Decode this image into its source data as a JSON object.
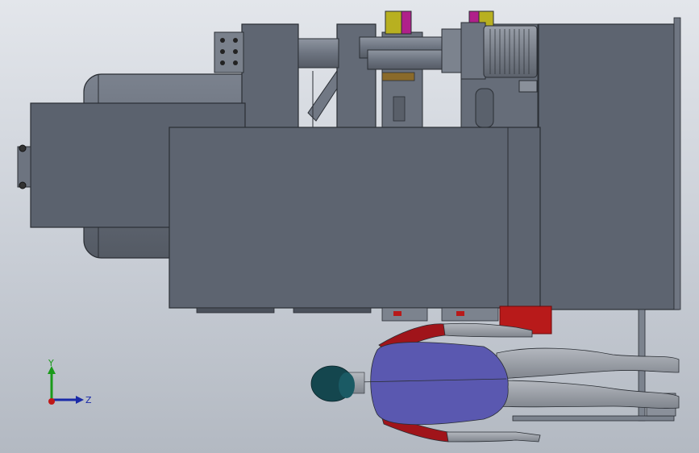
{
  "viewport": {
    "background_top": "#e3e6eb",
    "background_bottom": "#b3b9c2"
  },
  "colors": {
    "machine_body": "#5d6470",
    "machine_dark": "#4a5059",
    "machine_light": "#6b7380",
    "tank": "#686f7b",
    "steel_edge": "#2a2e34",
    "coupling_yellow": "#b8b020",
    "coupling_magenta": "#b0208a",
    "red_accent": "#b81a1a",
    "shirt_blue": "#5a58b0",
    "sleeve_red": "#a0141a",
    "skin_gray": "#9a9ea6",
    "hair_teal": "#14464e"
  },
  "triad": {
    "y_label": "Y",
    "z_label": "Z",
    "y_color": "#1a9a1a",
    "z_color": "#1a2aa8",
    "origin_color": "#c01818"
  }
}
